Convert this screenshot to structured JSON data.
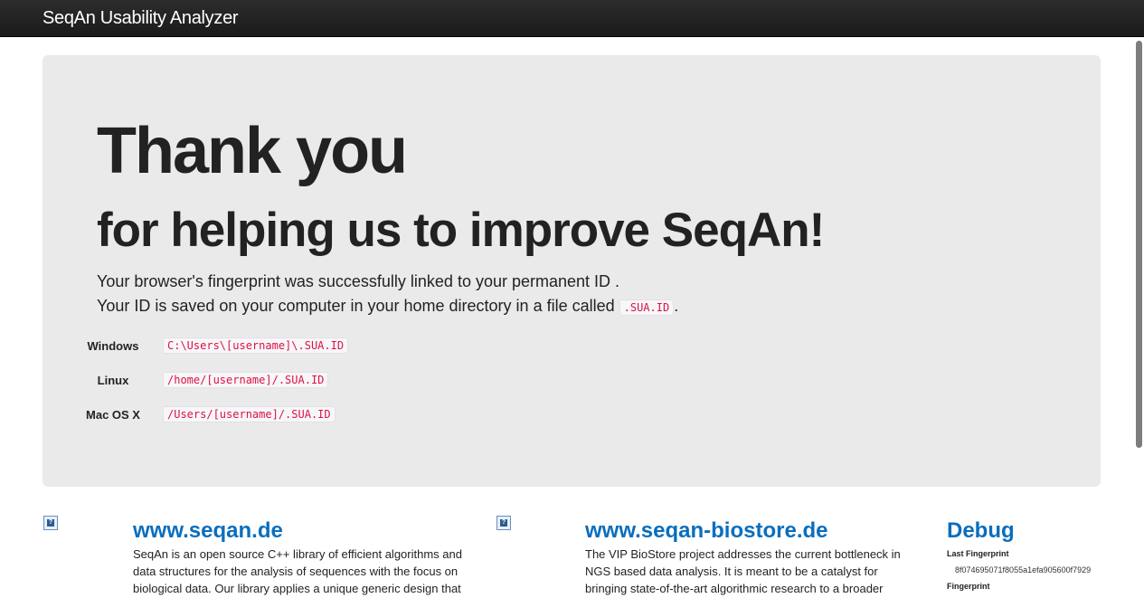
{
  "navbar": {
    "brand": "SeqAn Usability Analyzer"
  },
  "hero": {
    "title": "Thank you",
    "subtitle": "for helping us to improve SeqAn!",
    "line1": "Your browser's fingerprint was successfully linked to your permanent ID .",
    "line2_prefix": "Your ID is saved on your computer in your home directory in a file called ",
    "line2_code": ".SUA.ID",
    "line2_suffix": ".",
    "paths": [
      {
        "os": "Windows",
        "path": "C:\\Users\\[username]\\.SUA.ID"
      },
      {
        "os": "Linux",
        "path": "/home/[username]/.SUA.ID"
      },
      {
        "os": "Mac OS X",
        "path": "/Users/[username]/.SUA.ID"
      }
    ]
  },
  "columns": {
    "seqan": {
      "title": "www.seqan.de",
      "text": "SeqAn is an open source C++ library of efficient algorithms and data structures for the analysis of sequences with the focus on biological data. Our library applies a unique generic design that"
    },
    "biostore": {
      "title": "www.seqan-biostore.de",
      "text": "The VIP BioStore project addresses the current bottleneck in NGS based data analysis. It is meant to be a catalyst for bringing state-of-the-art algorithmic research to a broader"
    },
    "debug": {
      "title": "Debug",
      "last_fingerprint_label": "Last Fingerprint",
      "last_fingerprint_value": "8f074695071f8055a1efa905600f7929",
      "fingerprint_label": "Fingerprint"
    }
  },
  "icons": {
    "help": "help-icon"
  },
  "colors": {
    "navbar": "#1b1b1b",
    "hero_bg": "#eaeaea",
    "link": "#0a6ebd",
    "code": "#d14"
  }
}
